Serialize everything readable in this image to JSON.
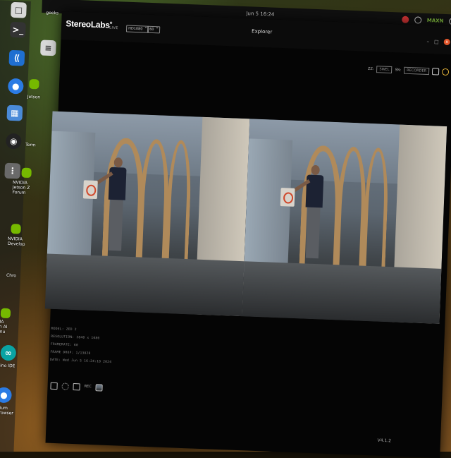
{
  "desktop": {
    "clock": "Jun 5  16:24",
    "tray_badge": "MAXN",
    "tray_help": "?"
  },
  "dock": {
    "labels": [
      "geeks",
      "Jetson",
      "Jetson",
      "Term",
      "Jetson",
      "NVIDIA Jetson Z Forum",
      "NVIDIA Develop",
      "Chro",
      "NVIDIA Jetson AI Commu",
      "Arduino IDE",
      "Chromium Web Browser"
    ],
    "icons": [
      "files-icon",
      "terminal-icon",
      "vscode-icon",
      "chromium-icon",
      "calendar-icon",
      "obs-icon",
      "nvidia-icon",
      "nvidia-icon",
      "nvidia-icon",
      "arduino-icon",
      "chromium-icon"
    ]
  },
  "window": {
    "brand": "StereoLabs",
    "brand_star": "*",
    "mode": "LIVE",
    "resolution_select": "HD1080",
    "fps_select": "60",
    "title": "Explorer",
    "ctrl_min": "–",
    "ctrl_max": "□",
    "ctrl_close": "x",
    "toolbar": {
      "z_label": "ZZ:",
      "depth_select": "SWEL",
      "sn_label": "SN:",
      "sn_value": "RECORDER"
    }
  },
  "info": {
    "model": "MODEL: ZED 2",
    "resolution": "RESOLUTION: 3840 x 1080",
    "framerate": "FRAMERATE: 60",
    "frame_drop": "FRAME DROP: 1/13020",
    "date": "DATE: Wed Jun 5 16:24:18 2024"
  },
  "bottom": {
    "status": "REC"
  },
  "version": "V4.1.2"
}
